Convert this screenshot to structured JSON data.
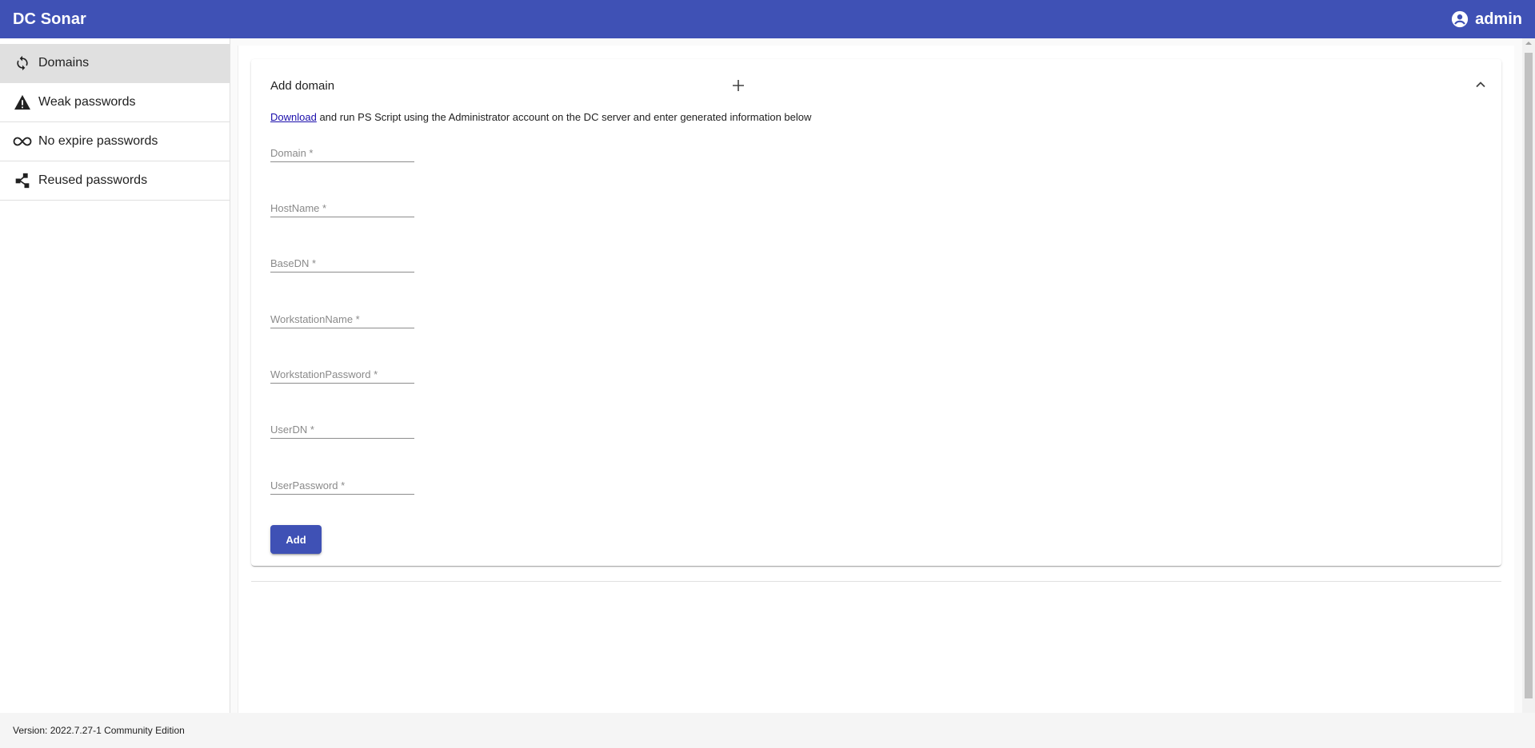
{
  "app": {
    "title": "DC Sonar",
    "user": "admin"
  },
  "sidebar": {
    "items": [
      {
        "label": "Domains",
        "icon": "sync-icon",
        "active": true
      },
      {
        "label": "Weak passwords",
        "icon": "warning-icon",
        "active": false
      },
      {
        "label": "No expire passwords",
        "icon": "infinity-icon",
        "active": false
      },
      {
        "label": "Reused passwords",
        "icon": "share-icon",
        "active": false
      }
    ]
  },
  "panel": {
    "title": "Add domain",
    "instructions_link": "Download",
    "instructions_text": " and run PS Script using the Administrator account on the DC server and enter generated information below",
    "fields": [
      {
        "placeholder": "Domain *",
        "value": ""
      },
      {
        "placeholder": "HostName *",
        "value": ""
      },
      {
        "placeholder": "BaseDN *",
        "value": ""
      },
      {
        "placeholder": "WorkstationName *",
        "value": ""
      },
      {
        "placeholder": "WorkstationPassword *",
        "value": ""
      },
      {
        "placeholder": "UserDN *",
        "value": ""
      },
      {
        "placeholder": "UserPassword *",
        "value": ""
      }
    ],
    "add_label": "Add"
  },
  "footer": {
    "version": "Version: 2022.7.27-1 Community Edition"
  },
  "colors": {
    "primary": "#3f51b5",
    "active_nav": "#e0e0e0",
    "link": "#1a0dab"
  }
}
